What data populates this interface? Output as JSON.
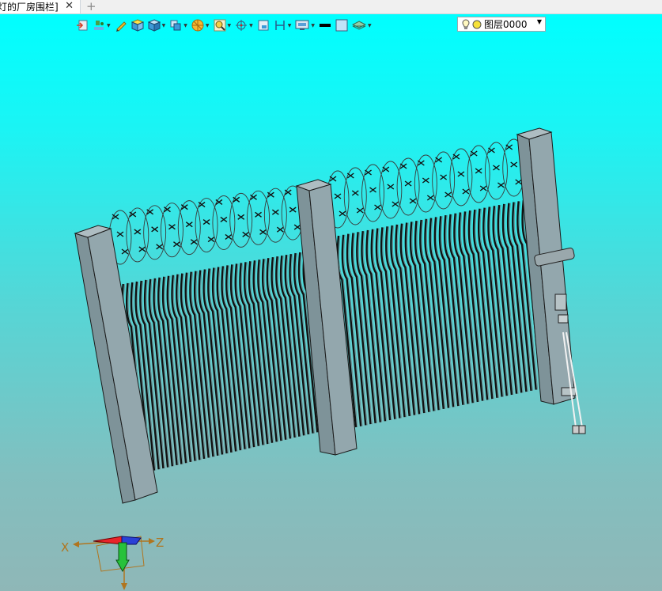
{
  "tab": {
    "title": "灯的厂房围栏]",
    "close": "✕",
    "add": "+"
  },
  "toolbar": {
    "icons": [
      "exit-icon",
      "paint-icon",
      "pencil-icon",
      "cube-shaded-icon",
      "cube-view-icon",
      "view-orient-icon",
      "render-sphere-icon",
      "zoom-icon",
      "pan-icon",
      "section-icon",
      "dimension-icon",
      "display-settings-icon",
      "color-black-swatch",
      "color-light-swatch",
      "layers-icon"
    ],
    "layer": {
      "name": "图层0000",
      "arrow": "▼"
    }
  },
  "triad": {
    "x_label": "X",
    "z_label": "Z"
  },
  "colors": {
    "background_top": "#00ffff",
    "background_bottom": "#8fb7b7",
    "post": "#8fa3a9",
    "edge": "#1a1a1a"
  }
}
